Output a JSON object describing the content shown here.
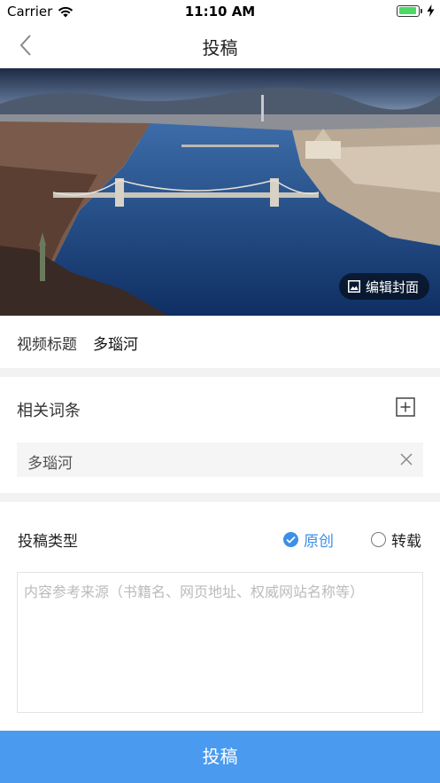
{
  "status_bar": {
    "carrier": "Carrier",
    "time": "11:10 AM"
  },
  "nav": {
    "title": "投稿",
    "back_icon": "chevron-left-icon"
  },
  "cover": {
    "edit_label": "编辑封面",
    "edit_icon": "image-icon"
  },
  "video_title": {
    "label": "视频标题",
    "value": "多瑙河"
  },
  "related": {
    "label": "相关词条",
    "add_icon": "plus-square-icon",
    "tags": [
      {
        "text": "多瑙河"
      }
    ]
  },
  "contribution_type": {
    "label": "投稿类型",
    "options": [
      {
        "label": "原创",
        "selected": true
      },
      {
        "label": "转载",
        "selected": false
      }
    ]
  },
  "source": {
    "placeholder": "内容参考来源（书籍名、网页地址、权威网站名称等）",
    "value": ""
  },
  "submit": {
    "label": "投稿"
  },
  "colors": {
    "accent": "#4a9af0",
    "radio_selected": "#3d8fe6",
    "divider": "#f2f2f2",
    "battery": "#4cd964"
  }
}
